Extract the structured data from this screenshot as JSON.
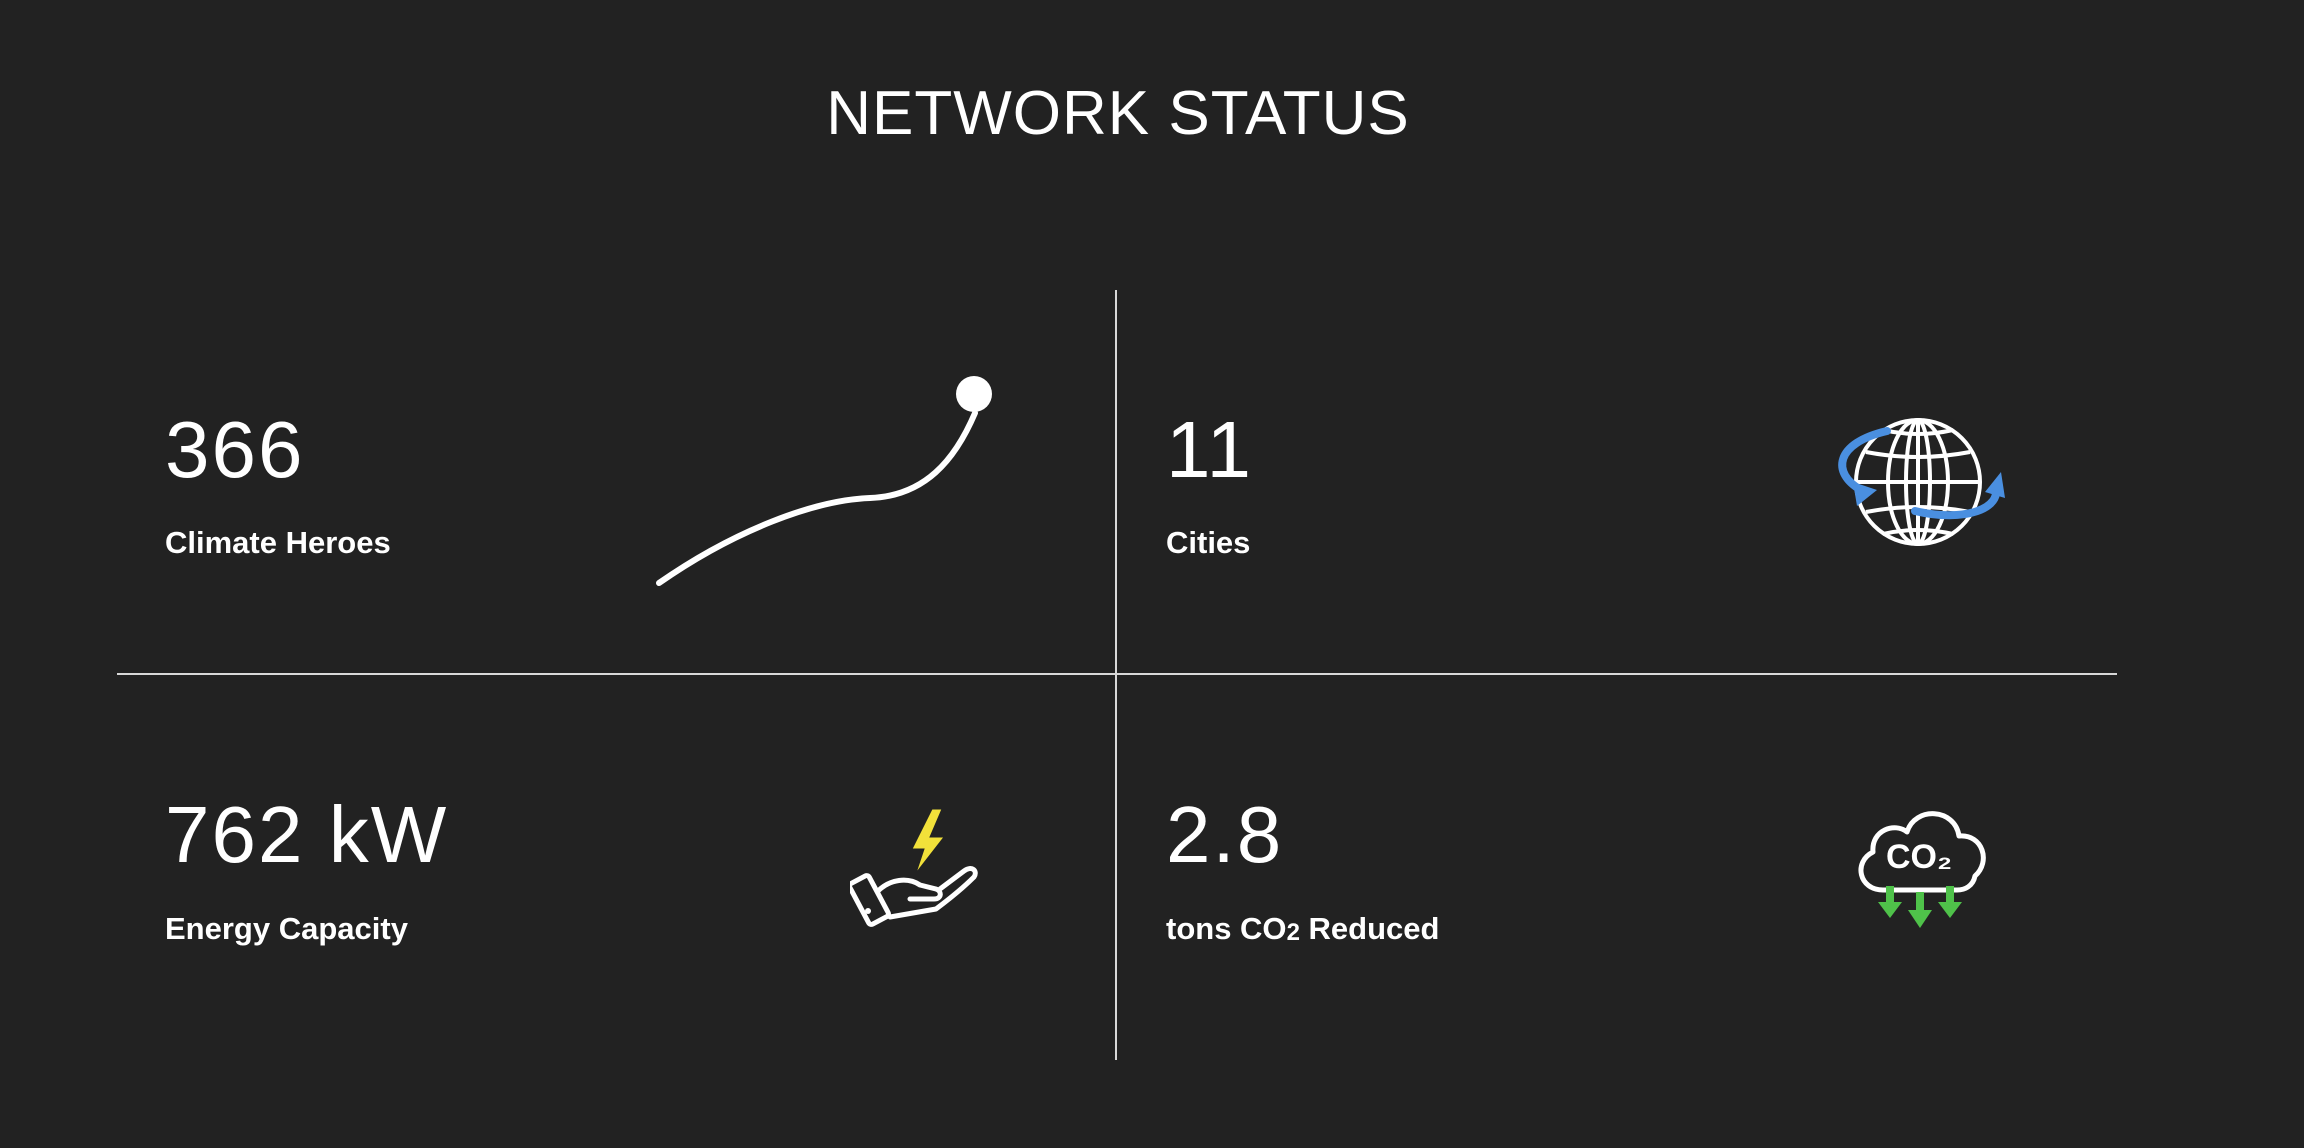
{
  "header": {
    "title": "NETWORK STATUS"
  },
  "stats": {
    "heroes": {
      "value": "366",
      "label": "Climate Heroes",
      "icon": "growth-curve-icon"
    },
    "cities": {
      "value": "11",
      "label": "Cities",
      "icon": "globe-icon"
    },
    "energy": {
      "value": "762 kW",
      "label": "Energy Capacity",
      "icon": "hand-lightning-icon"
    },
    "co2": {
      "value": "2.8",
      "label_prefix": "tons CO",
      "label_sub": "2",
      "label_suffix": " Reduced",
      "icon": "co2-cloud-icon",
      "icon_text": "CO₂"
    }
  },
  "colors": {
    "background": "#222222",
    "text": "#ffffff",
    "divider": "#d8d8d8",
    "globe_arrow": "#4a8fe0",
    "lightning": "#f2e13a",
    "co2_arrows": "#4fc24a"
  }
}
